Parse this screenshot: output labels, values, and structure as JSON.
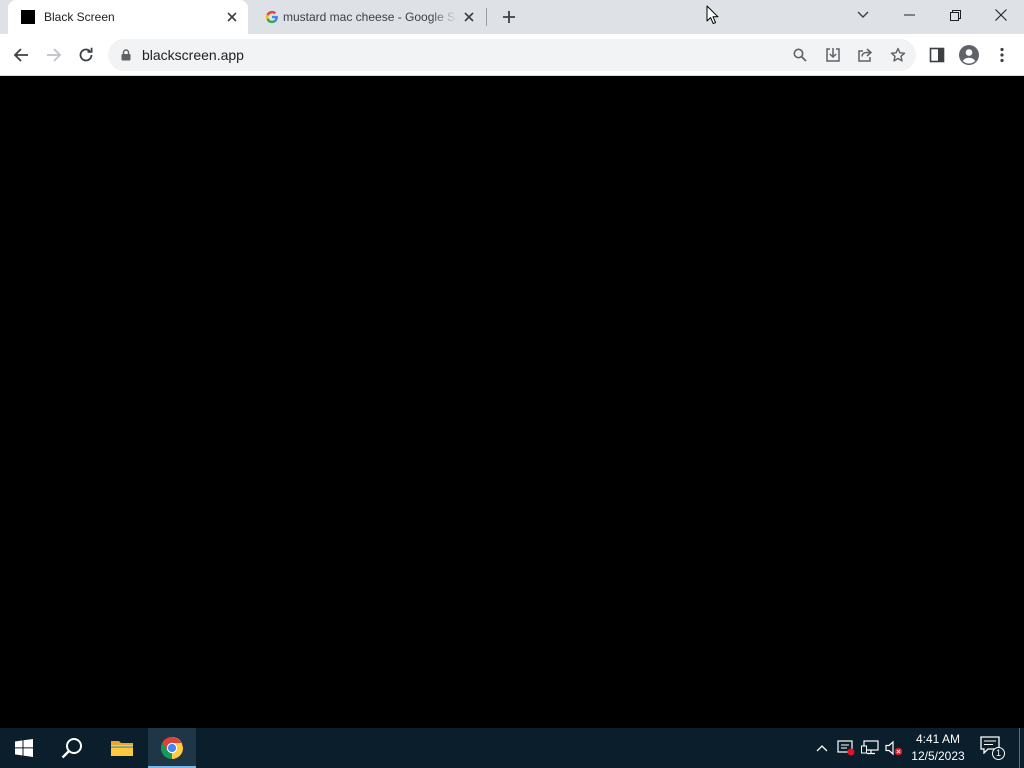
{
  "browser": {
    "tabs": [
      {
        "title": "Black Screen",
        "active": true,
        "favicon": "black-square-favicon"
      },
      {
        "title": "mustard mac cheese - Google Search",
        "active": false,
        "favicon": "google-g-favicon"
      }
    ],
    "address_bar": {
      "url": "blackscreen.app",
      "secure_icon": "lock-icon"
    },
    "toolbar_icons": [
      "back-icon",
      "forward-icon",
      "reload-icon",
      "search-icon",
      "install-icon",
      "share-icon",
      "star-icon",
      "side-panel-icon",
      "profile-icon",
      "menu-icon"
    ],
    "window_controls": [
      "tab-search-icon",
      "minimize-icon",
      "restore-icon",
      "close-icon"
    ]
  },
  "page": {
    "background": "#000000"
  },
  "taskbar": {
    "pinned": [
      "start-icon",
      "search-icon",
      "file-explorer-icon",
      "chrome-icon"
    ],
    "tray_icons": [
      "chevron-up-icon",
      "defender-icon",
      "network-icon",
      "volume-muted-icon"
    ],
    "clock": {
      "time": "4:41 AM",
      "date": "12/5/2023"
    },
    "notification_count": "1"
  },
  "colors": {
    "tabstrip": "#dee1e6",
    "toolbar": "#ffffff",
    "omnibox": "#f1f3f4",
    "taskbar": "#0a1e2c",
    "accent": "#76b9ed"
  }
}
